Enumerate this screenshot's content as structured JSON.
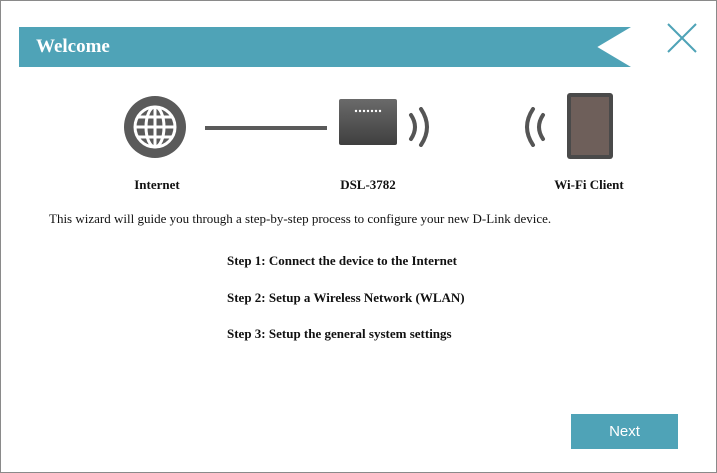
{
  "dialog": {
    "title": "Welcome",
    "close_icon": "close-icon"
  },
  "diagram": {
    "internet_label": "Internet",
    "device_label": "DSL-3782",
    "client_label": "Wi-Fi Client",
    "icons": [
      "globe-icon",
      "router-icon",
      "wifi-signal-icon",
      "tablet-icon"
    ]
  },
  "intro_text": "This wizard will guide you through a step-by-step process to configure your new D-Link device.",
  "steps": [
    "Step 1: Connect the device to the Internet",
    "Step 2: Setup a Wireless Network (WLAN)",
    "Step 3: Setup the general system settings"
  ],
  "buttons": {
    "next_label": "Next"
  },
  "colors": {
    "accent": "#4fa3b7",
    "icon_gray": "#555555"
  }
}
